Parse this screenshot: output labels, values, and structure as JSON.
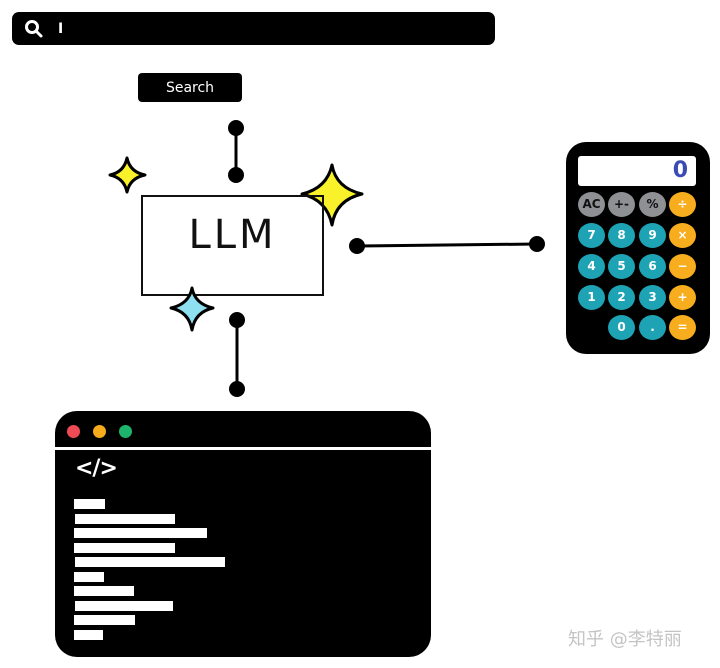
{
  "search": {
    "icon": "search-icon",
    "input_value": "I",
    "button_label": "Search"
  },
  "llm": {
    "label": "LLM",
    "sparkles": [
      {
        "color": "#f9f12a",
        "name": "small-yellow-sparkle"
      },
      {
        "color": "#f9f12a",
        "name": "large-yellow-sparkle"
      },
      {
        "color": "#8ee0f0",
        "name": "blue-sparkle"
      }
    ]
  },
  "calculator": {
    "display": "0",
    "keys": [
      {
        "label": "AC",
        "type": "gray"
      },
      {
        "label": "+-",
        "type": "gray"
      },
      {
        "label": "%",
        "type": "gray"
      },
      {
        "label": "÷",
        "type": "orange"
      },
      {
        "label": "7",
        "type": "teal"
      },
      {
        "label": "8",
        "type": "teal"
      },
      {
        "label": "9",
        "type": "teal"
      },
      {
        "label": "×",
        "type": "orange"
      },
      {
        "label": "4",
        "type": "teal"
      },
      {
        "label": "5",
        "type": "teal"
      },
      {
        "label": "6",
        "type": "teal"
      },
      {
        "label": "−",
        "type": "orange"
      },
      {
        "label": "1",
        "type": "teal"
      },
      {
        "label": "2",
        "type": "teal"
      },
      {
        "label": "3",
        "type": "teal"
      },
      {
        "label": "+",
        "type": "orange"
      },
      {
        "label": "0",
        "type": "teal"
      },
      {
        "label": ".",
        "type": "teal"
      },
      {
        "label": "=",
        "type": "orange"
      }
    ],
    "colors": {
      "gray": "#8f9094",
      "teal": "#1ea3b5",
      "orange": "#f7ad1d",
      "display_text": "#3a4bb5"
    }
  },
  "code_window": {
    "window_dots": [
      {
        "name": "close-dot",
        "color": "#ee4b55"
      },
      {
        "name": "minimize-dot",
        "color": "#f5ab1b"
      },
      {
        "name": "maximize-dot",
        "color": "#1db56b"
      }
    ],
    "code_tag": "</>",
    "code_line_count": 10
  },
  "watermark": "知乎 @李特丽"
}
